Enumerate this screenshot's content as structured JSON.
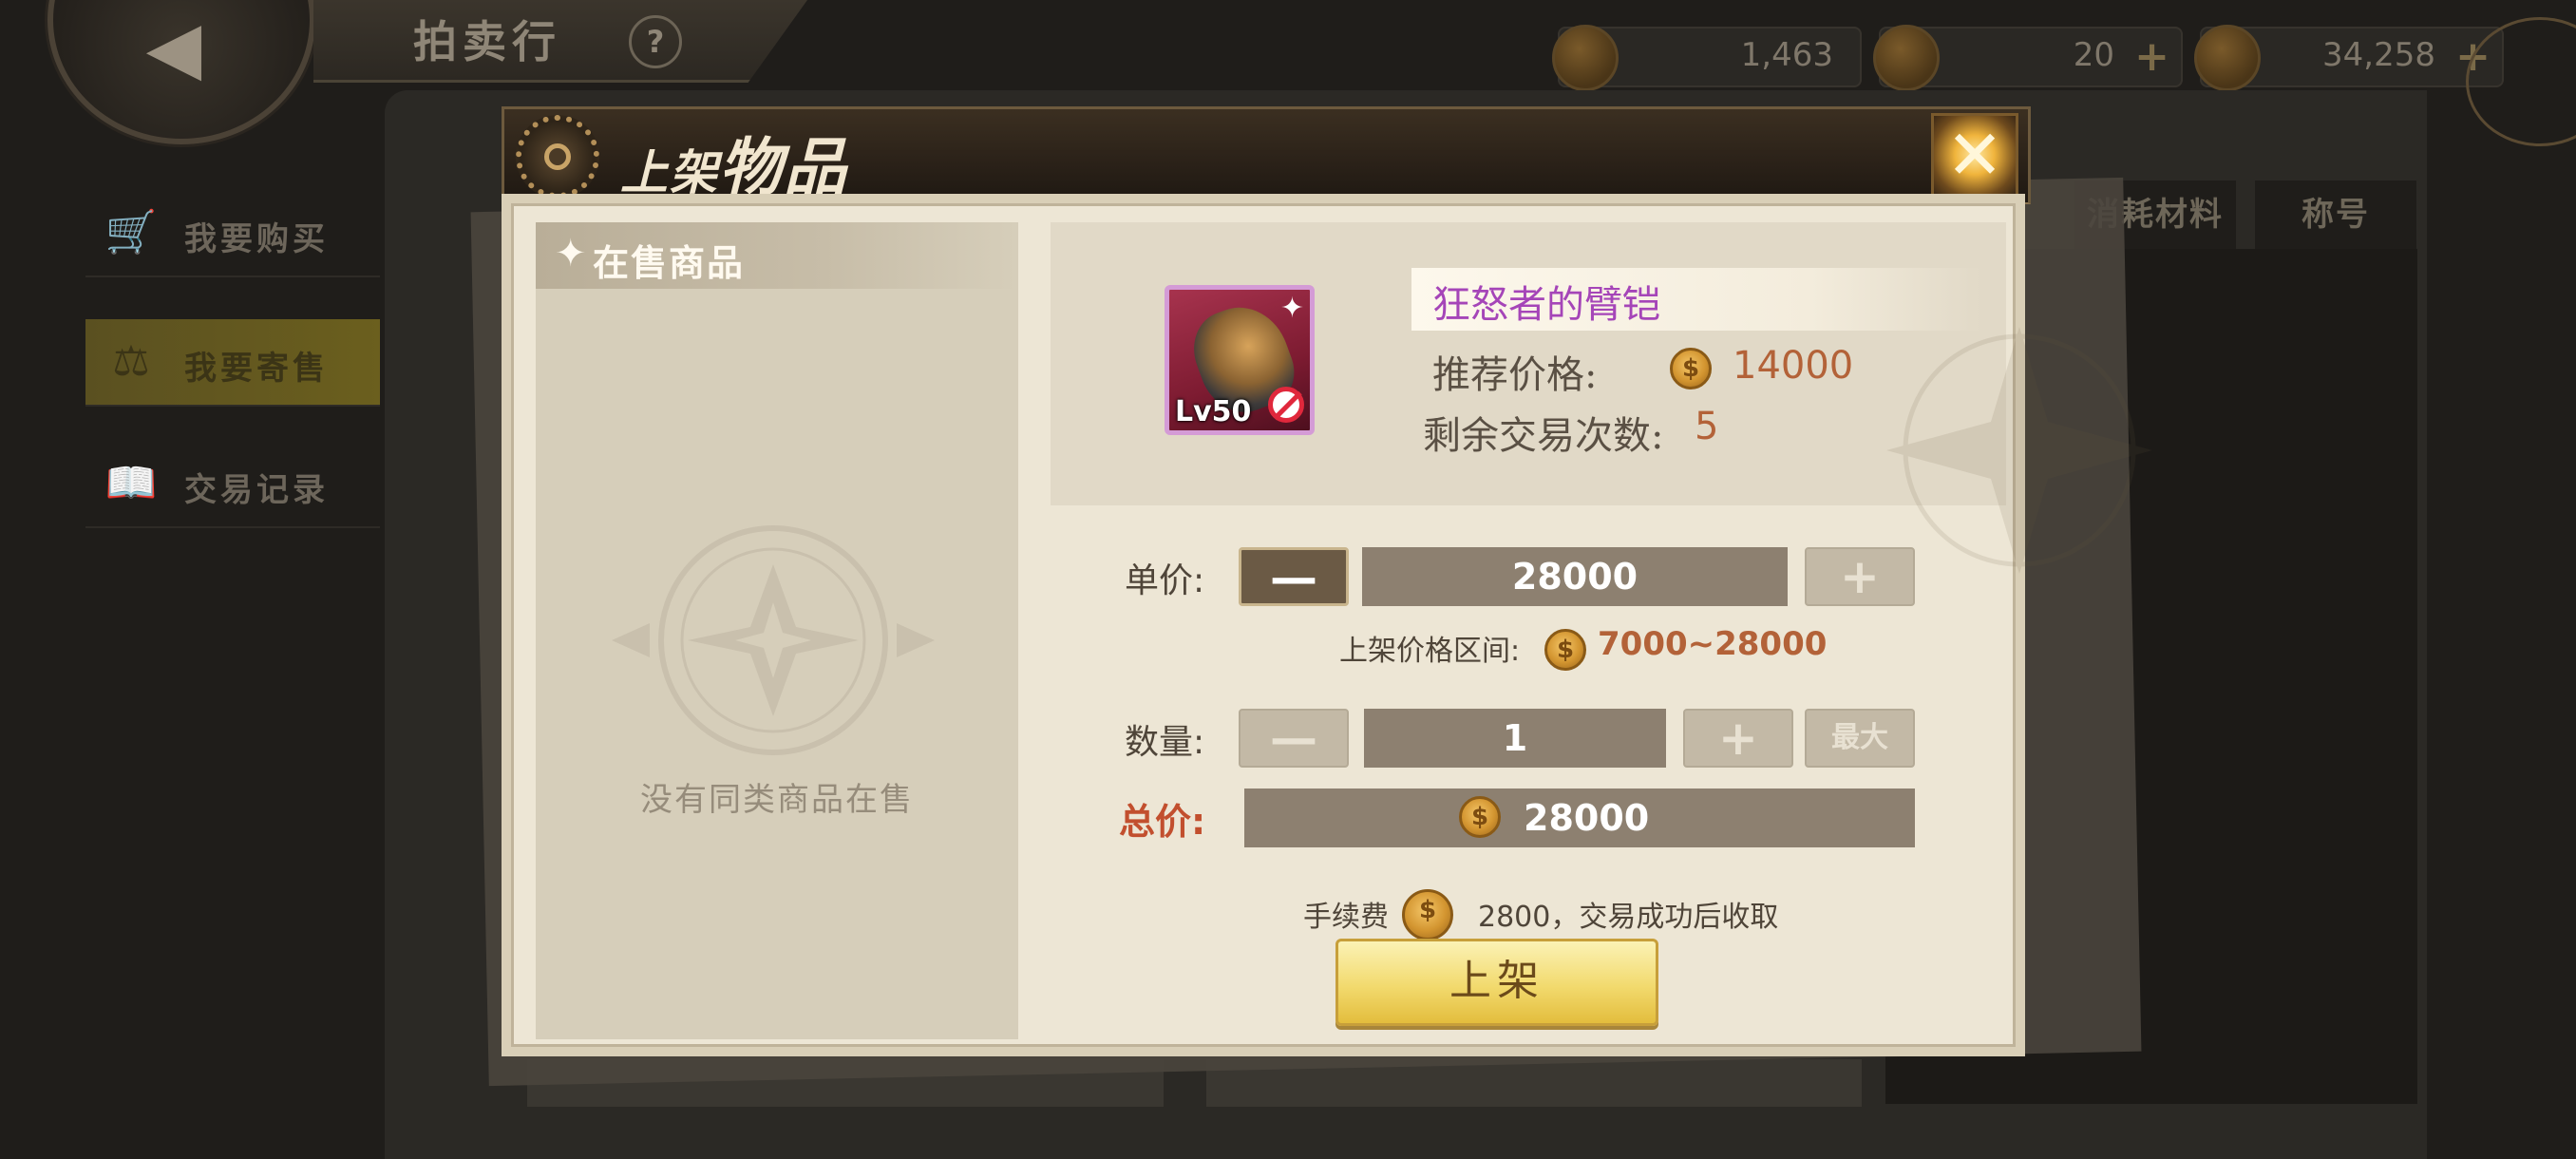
{
  "header": {
    "back_icon": "back-arrow-icon",
    "title": "拍卖行",
    "help": "?"
  },
  "currencies": [
    {
      "icon": "locked-gem-icon",
      "value": "1,463"
    },
    {
      "icon": "gem-icon",
      "value": "20",
      "plus": "+"
    },
    {
      "icon": "gold-coin-icon",
      "value": "34,258",
      "plus": "+"
    }
  ],
  "side_nav": [
    {
      "label": "我要购买",
      "icon": "cart-icon",
      "active": false
    },
    {
      "label": "我要寄售",
      "icon": "scale-icon",
      "active": true
    },
    {
      "label": "交易记录",
      "icon": "book-icon",
      "active": false
    }
  ],
  "right_tabs": [
    "消耗材料",
    "称号"
  ],
  "modal": {
    "title_small": "上架",
    "title_big": "物品",
    "close": "✕",
    "sale_panel": {
      "header": "在售商品",
      "empty_text": "没有同类商品在售"
    },
    "item": {
      "name": "狂怒者的臂铠",
      "level": "Lv50",
      "recommended_label": "推荐价格:",
      "recommended_price": "14000",
      "remaining_label": "剩余交易次数:",
      "remaining_count": "5"
    },
    "unit_price": {
      "label": "单价:",
      "minus": "—",
      "value": "28000",
      "plus": "+"
    },
    "price_range": {
      "label": "上架价格区间:",
      "value": "7000~28000"
    },
    "quantity": {
      "label": "数量:",
      "minus": "—",
      "value": "1",
      "plus": "+",
      "max": "最大"
    },
    "total": {
      "label": "总价:",
      "value": "28000"
    },
    "fee": {
      "label": "手续费",
      "value": "2800，交易成功后收取"
    },
    "list_button": "上架"
  },
  "colors": {
    "accent_gold": "#f2da6e",
    "price_orange": "#b36238",
    "item_purple": "#a545b8",
    "total_red": "#c24f2e"
  }
}
